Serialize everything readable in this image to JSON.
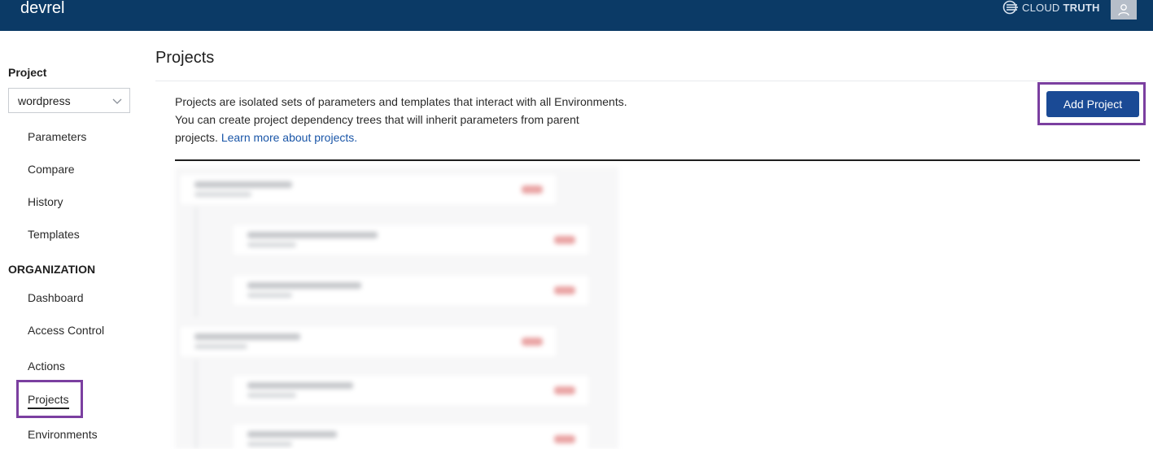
{
  "topbar": {
    "org_name": "devrel",
    "brand_light": "CLOUD",
    "brand_bold": "TRUTH",
    "brand_icon": "cloudtruth-logo-icon",
    "avatar_icon": "user-icon"
  },
  "sidebar": {
    "project_label": "Project",
    "project_select": {
      "value": "wordpress",
      "icon": "chevron-down-icon"
    },
    "project_items": [
      "Parameters",
      "Compare",
      "History",
      "Templates"
    ],
    "org_label": "ORGANIZATION",
    "org_items": [
      "Dashboard",
      "Access Control",
      "Actions",
      "Projects",
      "Environments"
    ],
    "active_item": "Projects"
  },
  "main": {
    "title": "Projects",
    "description_line1": "Projects are isolated sets of parameters and templates that interact with all Environments.",
    "description_line2": "You can create project dependency trees that will inherit parameters from parent",
    "description_line3": "projects.",
    "learn_more": "Learn more about projects.",
    "add_button": "Add Project"
  },
  "colors": {
    "topbar_bg": "#0b3a66",
    "primary_button": "#1a4a95",
    "highlight": "#7b3fa0",
    "link": "#1a56a8"
  }
}
